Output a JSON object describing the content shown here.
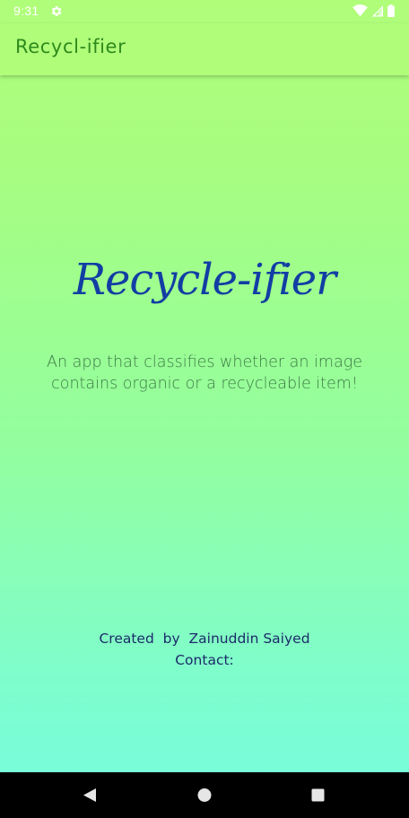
{
  "status_bar": {
    "time": "9:31",
    "icons": [
      "gear-icon",
      "wifi-icon",
      "signal-icon",
      "battery-icon"
    ]
  },
  "app_bar": {
    "title": "Recycl-ifier",
    "background": "#b0fd7a",
    "title_color": "#2e8a1c"
  },
  "main": {
    "hero_title": "Recycle-ifier",
    "hero_color": "#123ea4",
    "subtitle": "An app that classifies whether an image contains organic or a recycleable item!",
    "created_by": "Created  by  Zainuddin Saiyed",
    "contact": "Contact:"
  },
  "nav_bar": {
    "buttons": [
      "back-icon",
      "home-icon",
      "recents-icon"
    ]
  }
}
